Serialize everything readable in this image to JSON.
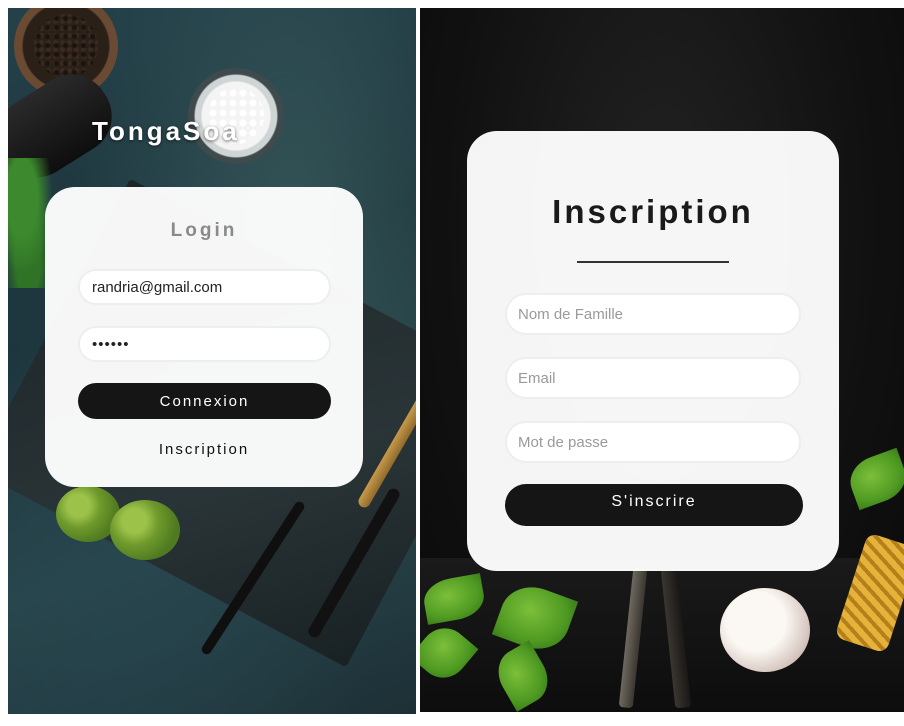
{
  "login_screen": {
    "brand": "TongaSoa",
    "card": {
      "title": "Login",
      "email_value": "randria@gmail.com",
      "password_value": "••••••",
      "connexion_label": "Connexion",
      "inscription_link": "Inscription"
    }
  },
  "register_screen": {
    "card": {
      "title": "Inscription",
      "name_placeholder": "Nom de Famille",
      "email_placeholder": "Email",
      "password_placeholder": "Mot de passe",
      "submit_label": "S'inscrire"
    }
  },
  "colors": {
    "card_background": "#ffffff",
    "button_background": "#151515",
    "button_text": "#ffffff"
  }
}
